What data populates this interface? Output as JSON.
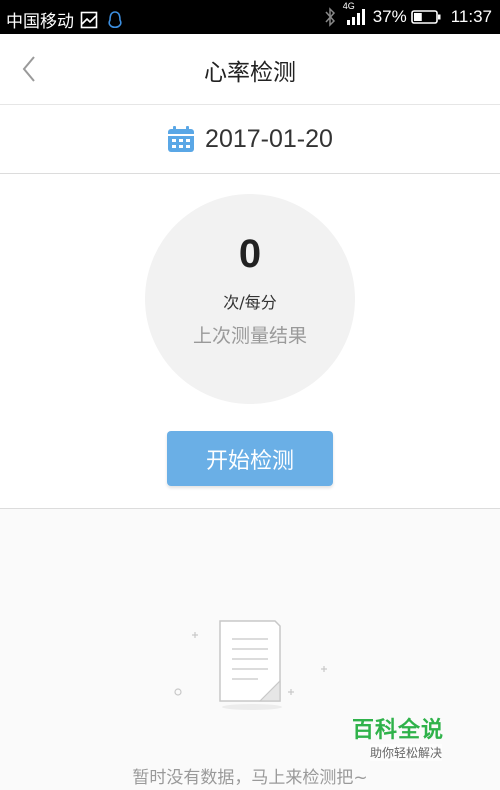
{
  "status_bar": {
    "carrier": "中国移动",
    "battery_percent": "37%",
    "time": "11:37",
    "network": "4G",
    "icons": [
      "gallery-icon",
      "qq-icon",
      "bluetooth-icon",
      "signal-icon",
      "battery-icon"
    ],
    "battery_level": 0.37
  },
  "header": {
    "title": "心率检测",
    "back_icon": "chevron-left-icon"
  },
  "date": {
    "value": "2017-01-20",
    "icon": "calendar-icon",
    "icon_color": "#5aa7e6"
  },
  "result": {
    "value": "0",
    "unit": "次/每分",
    "caption": "上次测量结果"
  },
  "actions": {
    "start_label": "开始检测",
    "button_color": "#6aafe6"
  },
  "empty_state": {
    "message": "暂时没有数据，马上来检测把~",
    "icon": "document-icon"
  },
  "watermark": {
    "title": "百科全说",
    "subtitle": "助你轻松解决",
    "color": "#2fb24a"
  }
}
